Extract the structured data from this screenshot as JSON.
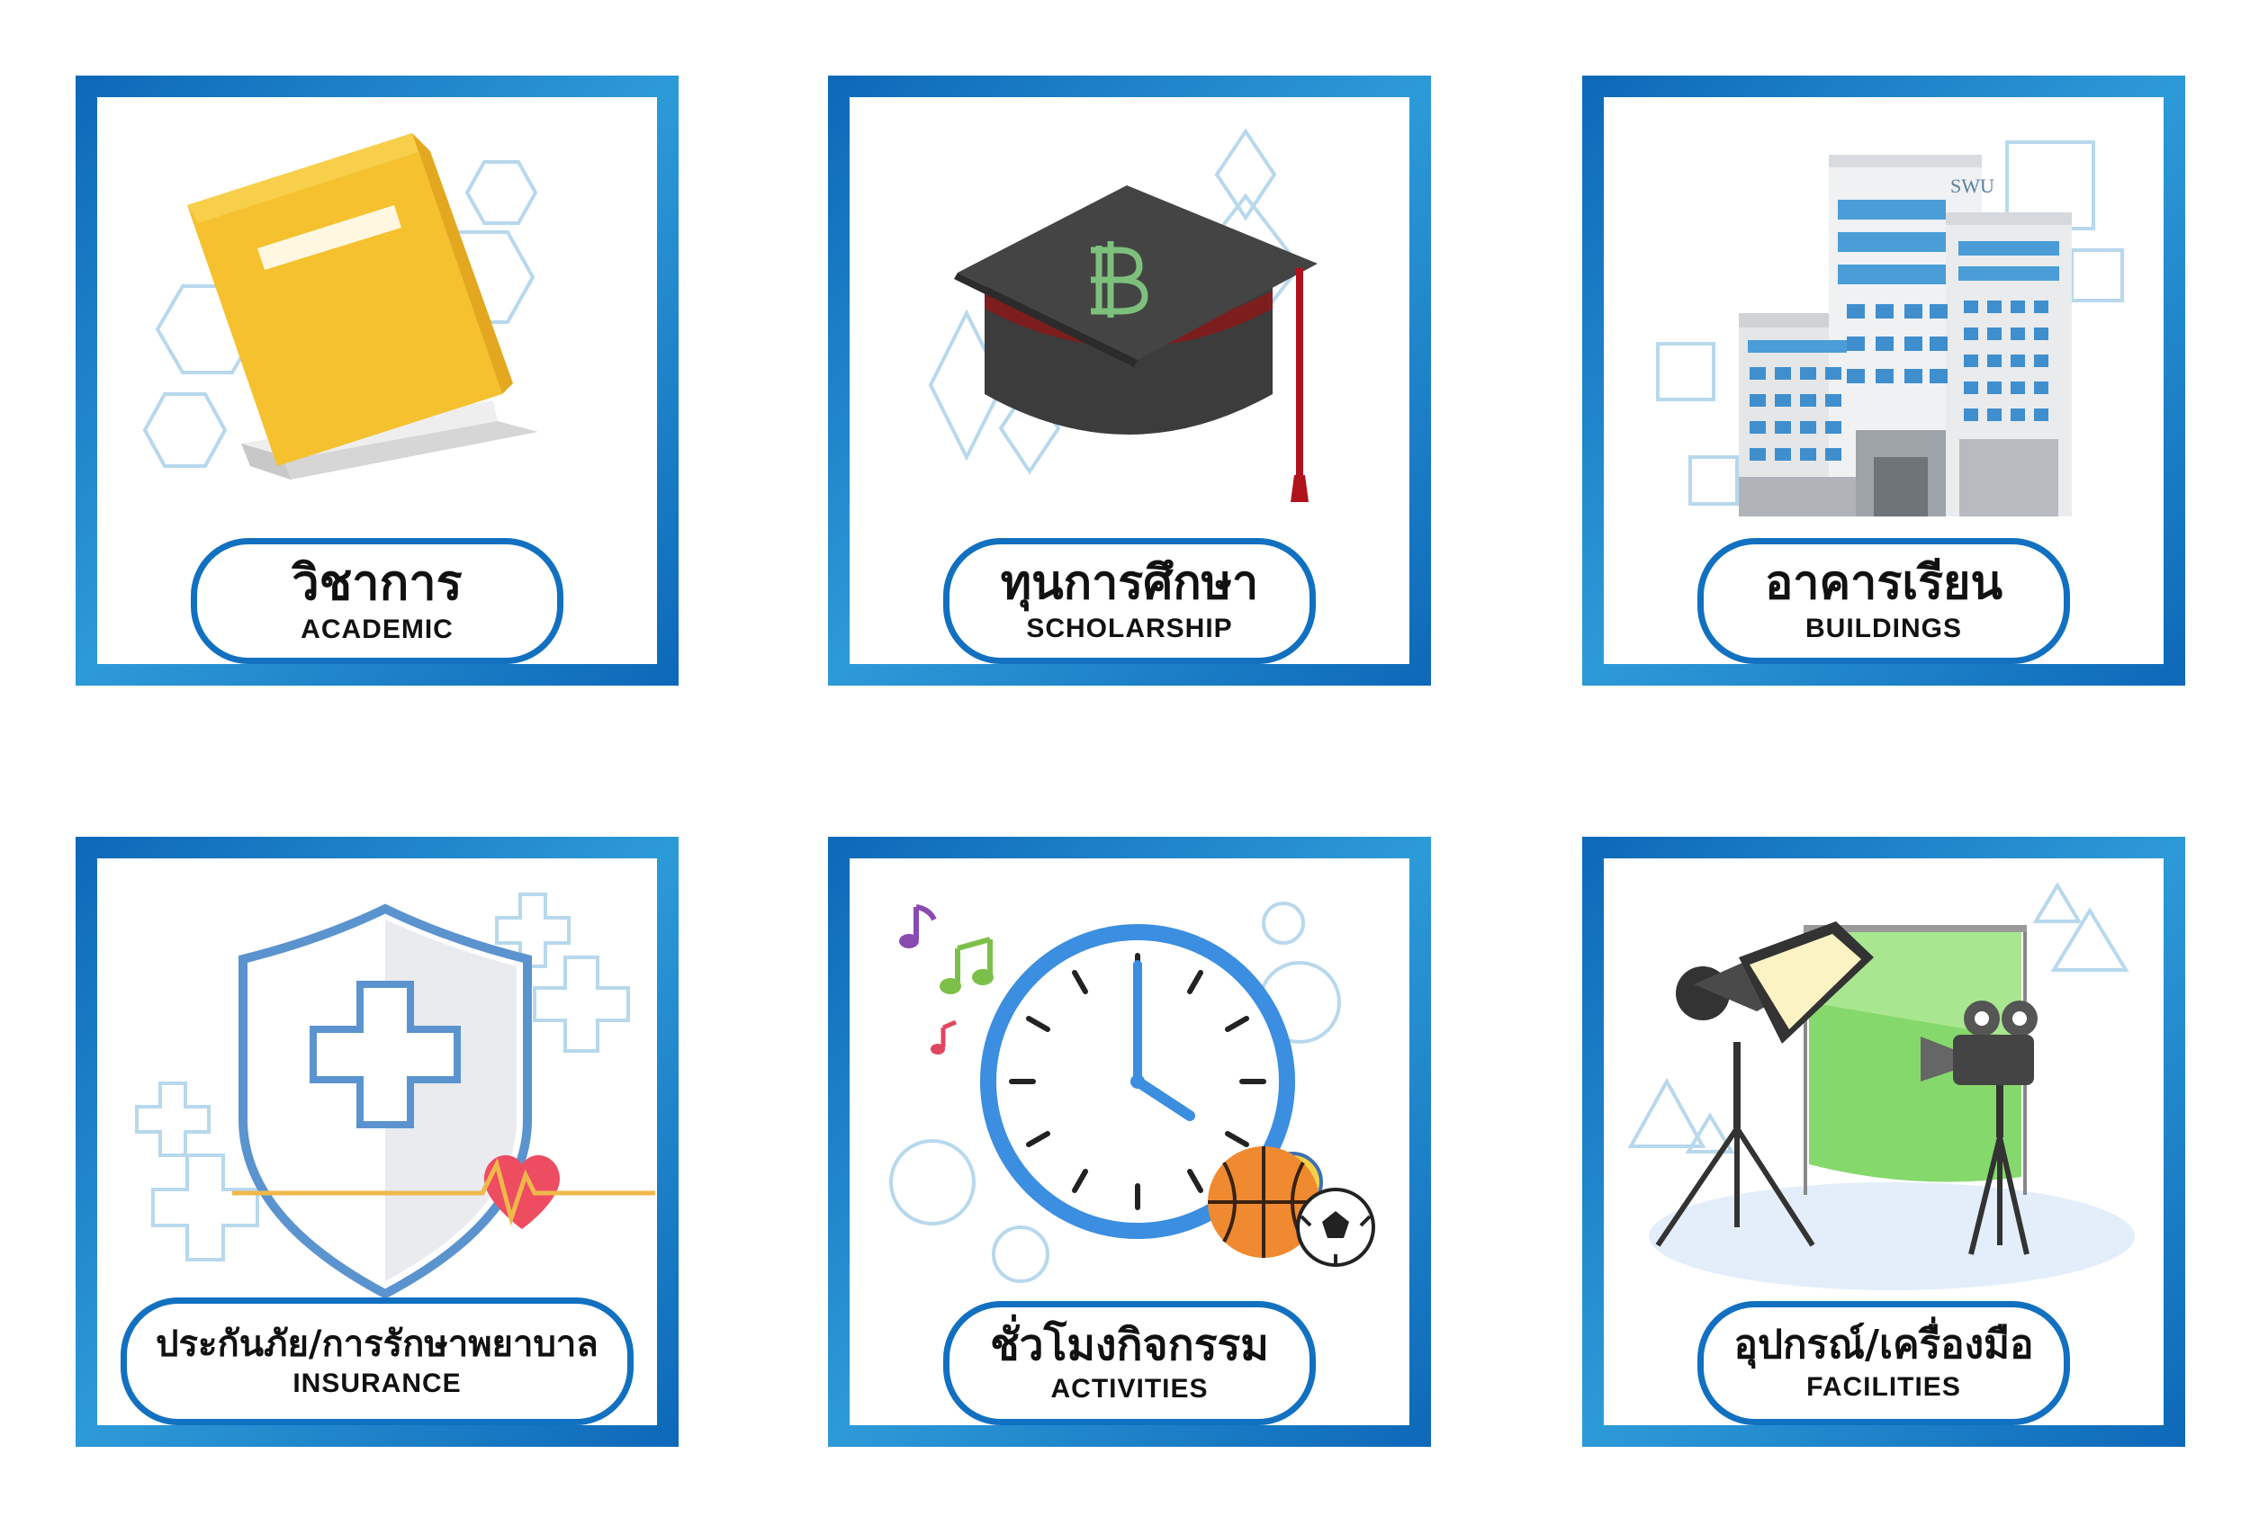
{
  "cards": [
    {
      "id": "academic",
      "title_th": "วิชาการ",
      "title_en": "ACADEMIC",
      "icon": "book-icon"
    },
    {
      "id": "scholarship",
      "title_th": "ทุนการศึกษา",
      "title_en": "SCHOLARSHIP",
      "icon": "graduation-cap-icon"
    },
    {
      "id": "buildings",
      "title_th": "อาคารเรียน",
      "title_en": "BUILDINGS",
      "icon": "buildings-icon",
      "sign": "SWU"
    },
    {
      "id": "insurance",
      "title_th": "ประกันภัย/การรักษาพยาบาล",
      "title_en": "INSURANCE",
      "icon": "shield-heart-icon"
    },
    {
      "id": "activities",
      "title_th": "ชั่วโมงกิจกรรม",
      "title_en": "ACTIVITIES",
      "icon": "clock-icon"
    },
    {
      "id": "facilities",
      "title_th": "อุปกรณ์/เครื่องมือ",
      "title_en": "FACILITIES",
      "icon": "studio-equipment-icon"
    }
  ],
  "colors": {
    "frame": "#1270c0",
    "accent": "#2d9ad8",
    "outline": "#b8d8ec"
  }
}
